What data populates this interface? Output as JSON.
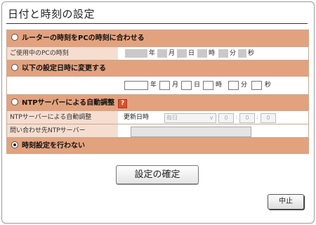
{
  "title": "日付と時刻の設定",
  "section_sync_pc": {
    "label": "ルーターの時刻をPCの時刻に合わせる",
    "selected": false,
    "pc_time_label": "ご使用中のPCの時刻",
    "units": [
      "年",
      "月",
      "日",
      "時",
      "分",
      "秒"
    ]
  },
  "section_manual": {
    "label": "以下の設定日時に変更する",
    "selected": false,
    "units": [
      "年",
      "月",
      "日",
      "時",
      "分",
      "秒"
    ]
  },
  "section_ntp": {
    "label": "NTPサーバーによる自動調整",
    "selected": false,
    "help_icon_text": "?",
    "auto_label": "NTPサーバーによる自動調整",
    "update_label": "更新日時",
    "frequency_value": "毎日",
    "hour_value": "0",
    "minute_value": "0",
    "second_value": "0",
    "server_label": "問い合わせ先NTPサーバー",
    "server_value": ""
  },
  "section_none": {
    "label": "時刻設定を行わない",
    "selected": true
  },
  "buttons": {
    "confirm": "設定の確定",
    "cancel": "中止"
  },
  "colors": {
    "section_bg": "#e3a27e",
    "label_bg": "#f5ddd0",
    "border": "#c8a890"
  }
}
